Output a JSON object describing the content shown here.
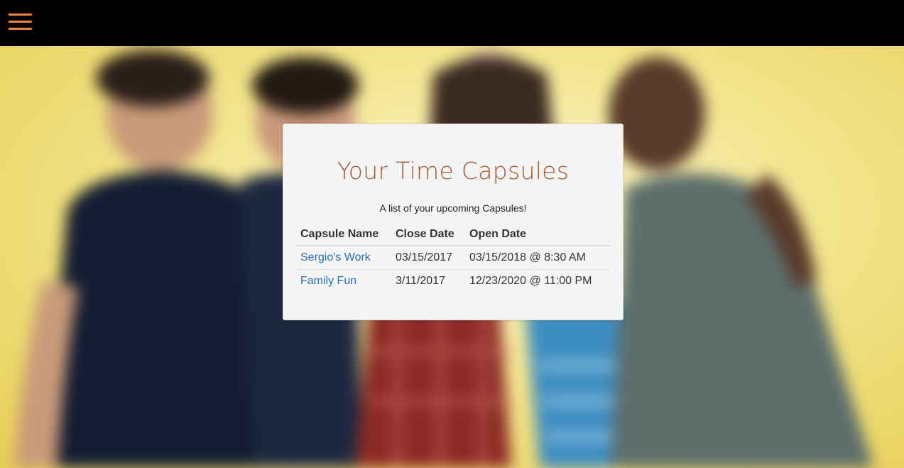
{
  "header": {
    "menu_icon": "hamburger-menu-icon",
    "accent": "#f0823a"
  },
  "carousel": {
    "indicator_count": 3
  },
  "card": {
    "title": "Your Time Capsules",
    "subtitle": "A list of your upcoming Capsules!",
    "columns": [
      "Capsule Name",
      "Close Date",
      "Open Date"
    ],
    "rows": [
      {
        "name": "Sergio's Work",
        "close": "03/15/2017",
        "open": "03/15/2018 @ 8:30 AM"
      },
      {
        "name": "Family Fun",
        "close": "3/11/2017",
        "open": "12/23/2020 @ 11:00 PM"
      }
    ],
    "title_color": "#a25a2d",
    "link_color": "#2a6fb0"
  }
}
